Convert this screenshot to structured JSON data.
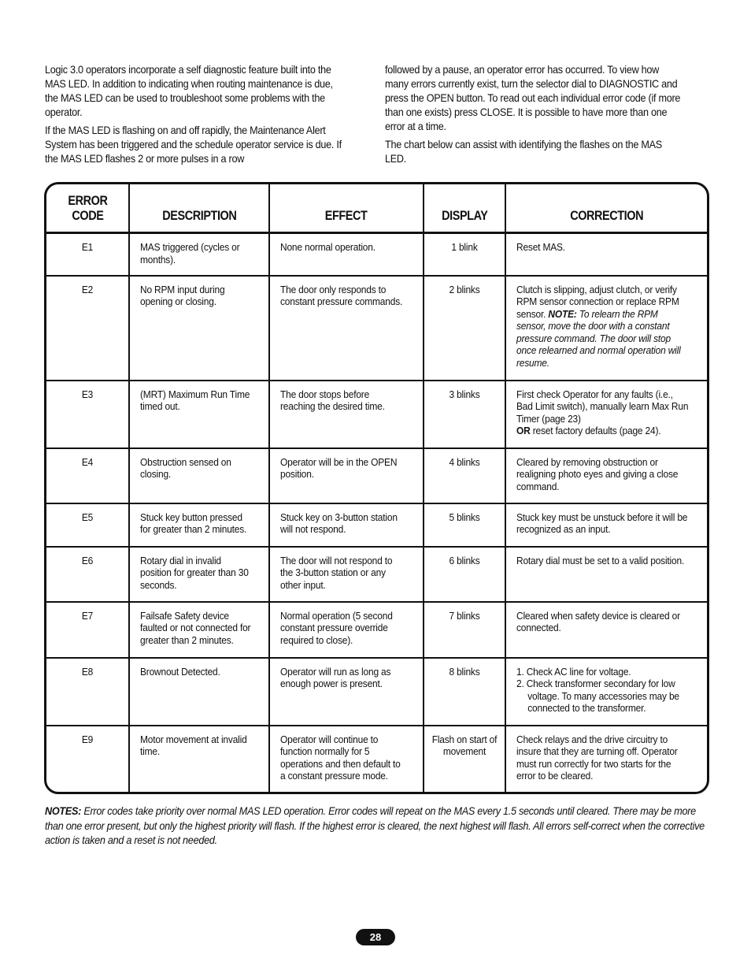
{
  "intro": {
    "left_paragraphs": [
      "Logic 3.0 operators incorporate a self diagnostic feature built into the MAS LED. In addition to indicating when routing maintenance is due, the MAS LED can be used to troubleshoot some problems with the operator.",
      "If the MAS LED is flashing on and off rapidly, the Maintenance Alert System has been triggered and the schedule operator service is due. If the MAS LED flashes 2 or more pulses in a row"
    ],
    "right_paragraphs": [
      "followed by a pause, an operator error has occurred. To view how many errors currently exist, turn the selector dial to DIAGNOSTIC and press the OPEN button. To read out each individual error code (if more than one exists) press CLOSE. It is possible to have more than one error at a time.",
      "The chart below can assist with identifying the flashes on the MAS LED."
    ]
  },
  "table": {
    "headers": {
      "code_line1": "ERROR",
      "code_line2": "CODE",
      "description": "DESCRIPTION",
      "effect": "EFFECT",
      "display": "DISPLAY",
      "correction": "CORRECTION"
    },
    "rows": [
      {
        "code": "E1",
        "description": "MAS triggered (cycles or months).",
        "effect": "None normal operation.",
        "display": "1 blink",
        "correction": "Reset MAS."
      },
      {
        "code": "E2",
        "description": "No RPM input during opening or closing.",
        "effect": "The door only responds to constant pressure commands.",
        "display": "2 blinks",
        "correction": "Clutch is slipping, adjust clutch, or verify RPM sensor connection or replace RPM sensor.",
        "correction_note_label": "NOTE:",
        "correction_note": "To relearn the RPM sensor, move the door with a constant pressure command. The door will stop once relearned and normal operation will resume."
      },
      {
        "code": "E3",
        "description": "(MRT) Maximum Run Time timed out.",
        "effect": "The door stops before reaching the desired time.",
        "display": "3 blinks",
        "correction": "First check Operator for any faults (i.e., Bad Limit switch), manually learn Max Run Timer (page 23)",
        "correction_or_label": "OR",
        "correction_or_text": "reset factory defaults (page 24)."
      },
      {
        "code": "E4",
        "description": "Obstruction sensed on closing.",
        "effect": "Operator will be in the OPEN position.",
        "display": "4 blinks",
        "correction": "Cleared by removing obstruction or realigning photo eyes and giving a close command."
      },
      {
        "code": "E5",
        "description": "Stuck key button pressed for greater than 2 minutes.",
        "effect": "Stuck key on 3-button station will not respond.",
        "display": "5 blinks",
        "correction": "Stuck key must be unstuck before it will be recognized as an input."
      },
      {
        "code": "E6",
        "description": "Rotary dial in invalid position for greater than 30 seconds.",
        "effect": "The door will not respond to the 3-button station or any other input.",
        "display": "6 blinks",
        "correction": "Rotary dial must be set to a valid position."
      },
      {
        "code": "E7",
        "description": "Failsafe Safety device faulted or not connected for greater than 2 minutes.",
        "effect": "Normal operation (5 second constant pressure override required to close).",
        "display": "7 blinks",
        "correction": "Cleared when safety device is cleared or connected."
      },
      {
        "code": "E8",
        "description": "Brownout Detected.",
        "effect": "Operator will run as long as enough power is present.",
        "display": "8 blinks",
        "correction_list": [
          "1. Check AC line for voltage.",
          "2. Check transformer secondary for low voltage. To many accessories may be connected to the transformer."
        ]
      },
      {
        "code": "E9",
        "description": "Motor movement at invalid time.",
        "effect": "Operator will continue to function normally for 5 operations and then default to a constant pressure mode.",
        "display": "Flash on start of movement",
        "correction": "Check relays and the drive circuitry to insure that they are turning off. Operator must run correctly for two starts for the error to be cleared."
      }
    ]
  },
  "notes": {
    "label": "NOTES:",
    "text": "Error codes take priority over normal MAS LED operation. Error codes will repeat on the MAS every 1.5 seconds until cleared. There may be more than one error present, but only the highest priority will flash. If the highest error is cleared, the next highest will flash. All errors self-correct when the corrective action is taken and a reset is not needed."
  },
  "page_number": "28"
}
